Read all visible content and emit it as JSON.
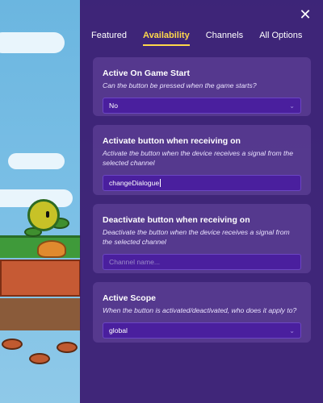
{
  "panel": {
    "close_glyph": "✕",
    "tabs": [
      {
        "label": "Featured",
        "active": false
      },
      {
        "label": "Availability",
        "active": true
      },
      {
        "label": "Channels",
        "active": false
      },
      {
        "label": "All Options",
        "active": false
      }
    ]
  },
  "settings": [
    {
      "title": "Active On Game Start",
      "description": "Can the button be pressed when the game starts?",
      "control": "select",
      "value": "No"
    },
    {
      "title": "Activate button when receiving on",
      "description": "Activate the button when the device receives a signal from the selected channel",
      "control": "input",
      "value": "changeDialogue",
      "placeholder": ""
    },
    {
      "title": "Deactivate button when receiving on",
      "description": "Deactivate the button when the device receives a signal from the selected channel",
      "control": "input",
      "value": "",
      "placeholder": "Channel name..."
    },
    {
      "title": "Active Scope",
      "description": "When the button is activated/deactivated, who does it apply to?",
      "control": "select",
      "value": "global"
    }
  ],
  "colors": {
    "panel_bg": "#3a1a70",
    "active_tab": "#ffd84a",
    "field_bg": "#4a1f9e"
  }
}
